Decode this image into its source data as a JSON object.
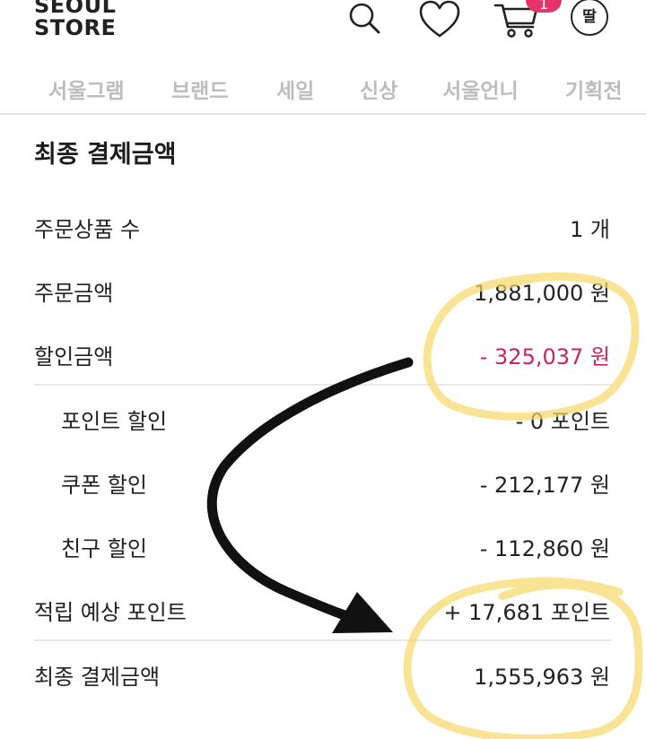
{
  "brand": {
    "logo_line1": "SEOUL",
    "logo_line2": "STORE"
  },
  "header": {
    "cart_count": "1",
    "avatar_label": "딸",
    "icons": [
      "search-icon",
      "heart-icon",
      "cart-icon"
    ]
  },
  "nav": {
    "items": [
      {
        "label": "서울그램"
      },
      {
        "label": "브랜드"
      },
      {
        "label": "세일"
      },
      {
        "label": "신상"
      },
      {
        "label": "서울언니"
      },
      {
        "label": "기획전"
      }
    ]
  },
  "summary": {
    "title": "최종 결제금액",
    "rows": [
      {
        "label": "주문상품 수",
        "value": "1 개"
      },
      {
        "label": "주문금액",
        "value": "1,881,000 원"
      },
      {
        "label": "할인금액",
        "value": "- 325,037 원"
      },
      {
        "label": "포인트 할인",
        "value": "- 0 포인트"
      },
      {
        "label": "쿠폰 할인",
        "value": "- 212,177 원"
      },
      {
        "label": "친구 할인",
        "value": "- 112,860 원"
      },
      {
        "label": "적립 예상 포인트",
        "value": "+ 17,681 포인트"
      },
      {
        "label": "최종 결제금액",
        "value": "1,555,963 원"
      }
    ]
  },
  "colors": {
    "discount": "#c9245f",
    "badge": "#e6336a",
    "highlight": "#f7d86a"
  }
}
